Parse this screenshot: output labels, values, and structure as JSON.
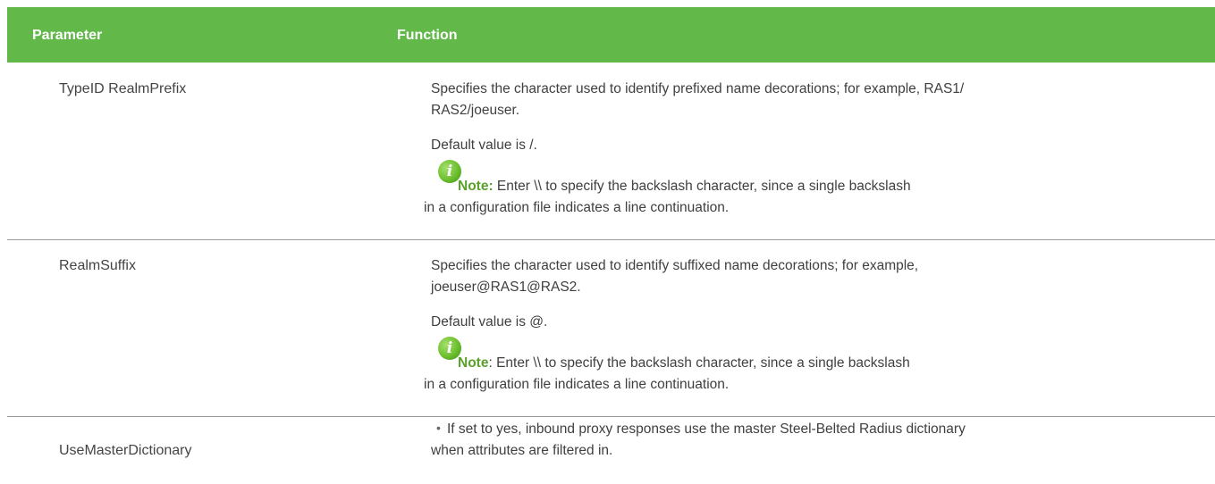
{
  "header": {
    "col1": "Parameter",
    "col2": "Function"
  },
  "rows": [
    {
      "parameter": "TypeID RealmPrefix",
      "desc_line1": "Specifies the character used to identify prefixed name decorations; for example, RAS1/",
      "desc_line2": "RAS2/joeuser.",
      "default": "Default value is /.",
      "note_label": "Note:",
      "note_line1": " Enter \\\\ to specify the backslash character, since a single backslash",
      "note_line2": "in a  configuration file indicates a line continuation."
    },
    {
      "parameter": "RealmSuffix",
      "desc_line1": "Specifies the character used to identify suffixed name decorations; for example,",
      "desc_line2": "joeuser@RAS1@RAS2.",
      "default": "Default value is @.",
      "note_label": "Note",
      "note_line1": ": Enter \\\\ to specify the backslash character, since a single backslash",
      "note_line2": "in a  configuration file indicates a line continuation."
    },
    {
      "parameter": "UseMasterDictionary",
      "bullet": "•",
      "desc_line1": "If set to yes, inbound proxy responses use the master Steel-Belted Radius dictionary",
      "desc_line2": "when attributes are filtered in."
    }
  ],
  "colors": {
    "header_bg": "#62b94a",
    "note_label": "#5aa12c",
    "note_icon": "#6cbf2e"
  },
  "icon": "info-icon"
}
